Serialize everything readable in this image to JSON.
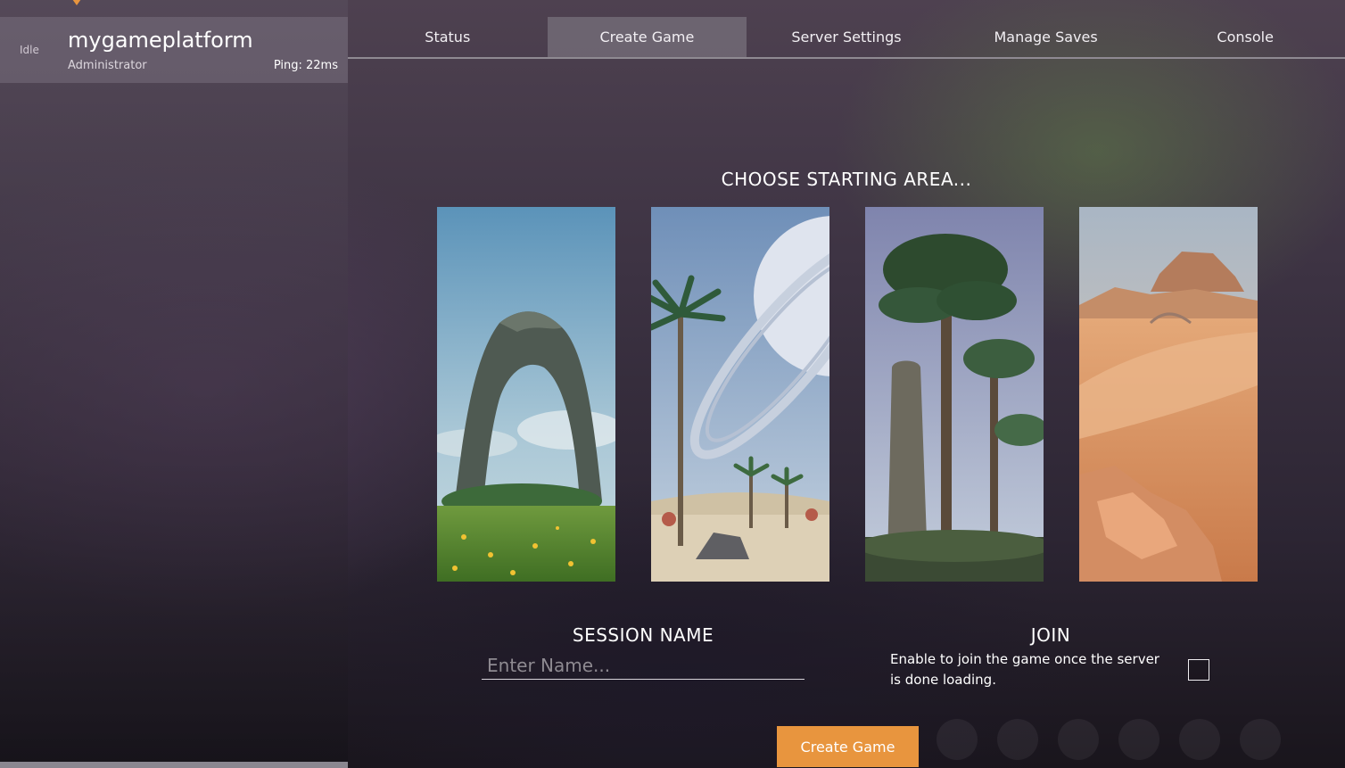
{
  "sidebar": {
    "status": "Idle",
    "server_name": "mygameplatform",
    "role": "Administrator",
    "ping": "Ping: 22ms"
  },
  "tabs": [
    {
      "label": "Status",
      "active": false
    },
    {
      "label": "Create Game",
      "active": true
    },
    {
      "label": "Server Settings",
      "active": false
    },
    {
      "label": "Manage Saves",
      "active": false
    },
    {
      "label": "Console",
      "active": false
    }
  ],
  "main": {
    "heading": "CHOOSE STARTING AREA...",
    "starting_areas": [
      {
        "icon": "grass-fields-arch-image"
      },
      {
        "icon": "desert-palms-planet-image"
      },
      {
        "icon": "tall-forest-image"
      },
      {
        "icon": "dune-desert-image"
      }
    ],
    "session": {
      "label": "SESSION NAME",
      "value": "",
      "placeholder": "Enter Name..."
    },
    "join": {
      "label": "JOIN",
      "description": "Enable to join the game once the server is done loading.",
      "checked": false
    },
    "create_button_label": "Create Game"
  },
  "colors": {
    "accent": "#e8953e",
    "active_tab": "#827d87",
    "panel": "#78707d"
  }
}
